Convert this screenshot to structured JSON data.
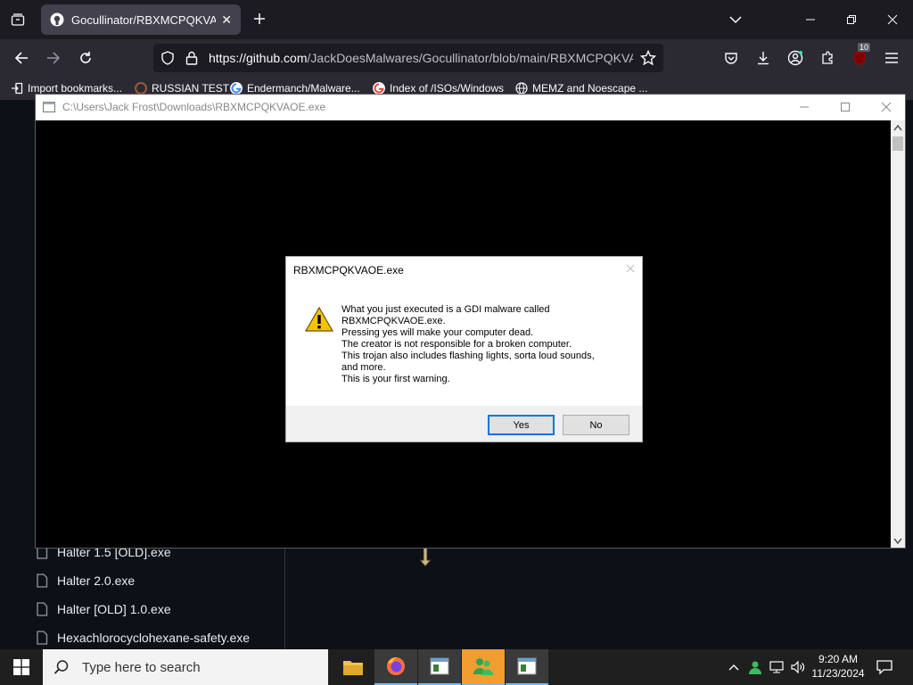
{
  "browser": {
    "tab": {
      "title": "Gocullinator/RBXMCPQKVAOE."
    },
    "url": {
      "host": "https://github.com",
      "path": "/JackDoesMalwares/Gocullinator/blob/main/RBXMCPQKVA"
    },
    "extension_badge": "10",
    "bookmarks": [
      {
        "label": "Import bookmarks..."
      },
      {
        "label": "RUSSIAN TEST"
      },
      {
        "label": "Endermanch/Malware..."
      },
      {
        "label": "Index of /ISOs/Windows"
      },
      {
        "label": "MEMZ and Noescape ..."
      }
    ]
  },
  "page": {
    "files": [
      {
        "name": "Halter 1.5 [OLD].exe"
      },
      {
        "name": "Halter 2.0.exe"
      },
      {
        "name": "Halter [OLD] 1.0.exe"
      },
      {
        "name": "Hexachlorocyclohexane-safety.exe"
      }
    ]
  },
  "malware_window": {
    "title": "C:\\Users\\Jack Frost\\Downloads\\RBXMCPQKVAOE.exe"
  },
  "dialog": {
    "title": "RBXMCPQKVAOE.exe",
    "message_lines": [
      "What you just executed is a GDI malware called",
      "RBXMCPQKVAOE.exe.",
      "Pressing yes will make your computer dead.",
      "The creator is not responsible for a broken computer.",
      "This trojan also includes flashing lights, sorta loud sounds,",
      "and more.",
      "This is your first warning."
    ],
    "yes_label": "Yes",
    "no_label": "No"
  },
  "taskbar": {
    "search_placeholder": "Type here to search",
    "time": "9:20 AM",
    "date": "11/23/2024"
  },
  "colors": {
    "browser_bg": "#1c1b22",
    "toolbar_bg": "#2b2a33",
    "dialog_accent": "#0078d7",
    "taskbar_bg": "#1f1f1f"
  }
}
